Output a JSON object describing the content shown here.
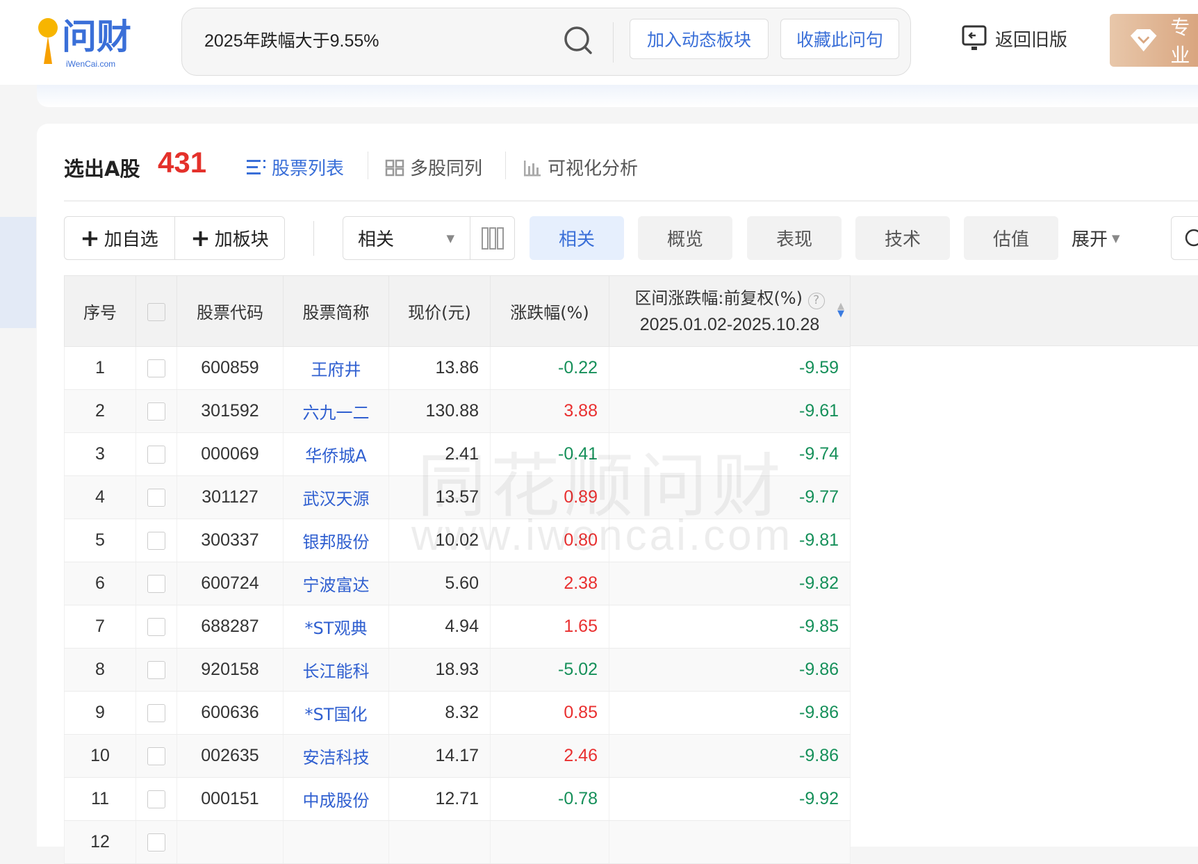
{
  "header": {
    "logo_text": "问财",
    "logo_sub": "iWenCai.com",
    "query": "2025年跌幅大于9.55%",
    "add_dynamic_sector": "加入动态板块",
    "save_question": "收藏此问句",
    "back_old_version": "返回旧版",
    "pro_label": "专业"
  },
  "result": {
    "title": "选出A股",
    "count": "431",
    "views": [
      "股票列表",
      "多股同列",
      "可视化分析"
    ]
  },
  "toolbar": {
    "add_watchlist": "加自选",
    "add_sector": "加板块",
    "sort_select": "相关",
    "tabs": [
      "相关",
      "概览",
      "表现",
      "技术",
      "估值"
    ],
    "active_tab": "相关",
    "expand": "展开"
  },
  "table": {
    "headers": {
      "seq": "序号",
      "code": "股票代码",
      "name": "股票简称",
      "price": "现价(元)",
      "change": "涨跌幅(%)",
      "range_change": "区间涨跌幅:前复权(%)",
      "range_dates": "2025.01.02-2025.10.28"
    },
    "rows": [
      {
        "seq": "1",
        "code": "600859",
        "name": "王府井",
        "price": "13.86",
        "change": "-0.22",
        "range": "-9.59"
      },
      {
        "seq": "2",
        "code": "301592",
        "name": "六九一二",
        "price": "130.88",
        "change": "3.88",
        "range": "-9.61"
      },
      {
        "seq": "3",
        "code": "000069",
        "name": "华侨城A",
        "price": "2.41",
        "change": "-0.41",
        "range": "-9.74"
      },
      {
        "seq": "4",
        "code": "301127",
        "name": "武汉天源",
        "price": "13.57",
        "change": "0.89",
        "range": "-9.77"
      },
      {
        "seq": "5",
        "code": "300337",
        "name": "银邦股份",
        "price": "10.02",
        "change": "0.80",
        "range": "-9.81"
      },
      {
        "seq": "6",
        "code": "600724",
        "name": "宁波富达",
        "price": "5.60",
        "change": "2.38",
        "range": "-9.82"
      },
      {
        "seq": "7",
        "code": "688287",
        "name": "*ST观典",
        "price": "4.94",
        "change": "1.65",
        "range": "-9.85"
      },
      {
        "seq": "8",
        "code": "920158",
        "name": "长江能科",
        "price": "18.93",
        "change": "-5.02",
        "range": "-9.86"
      },
      {
        "seq": "9",
        "code": "600636",
        "name": "*ST国化",
        "price": "8.32",
        "change": "0.85",
        "range": "-9.86"
      },
      {
        "seq": "10",
        "code": "002635",
        "name": "安洁科技",
        "price": "14.17",
        "change": "2.46",
        "range": "-9.86"
      },
      {
        "seq": "11",
        "code": "000151",
        "name": "中成股份",
        "price": "12.71",
        "change": "-0.78",
        "range": "-9.92"
      },
      {
        "seq": "12",
        "code": "",
        "name": "",
        "price": "",
        "change": "",
        "range": ""
      }
    ]
  },
  "watermark": {
    "cn": "同花顺问财",
    "url": "www.iwencai.com"
  },
  "colors": {
    "up": "#e93030",
    "down": "#16905a",
    "link": "#2f5fd0",
    "accent": "#3a6fd8",
    "count": "#e4312b"
  }
}
